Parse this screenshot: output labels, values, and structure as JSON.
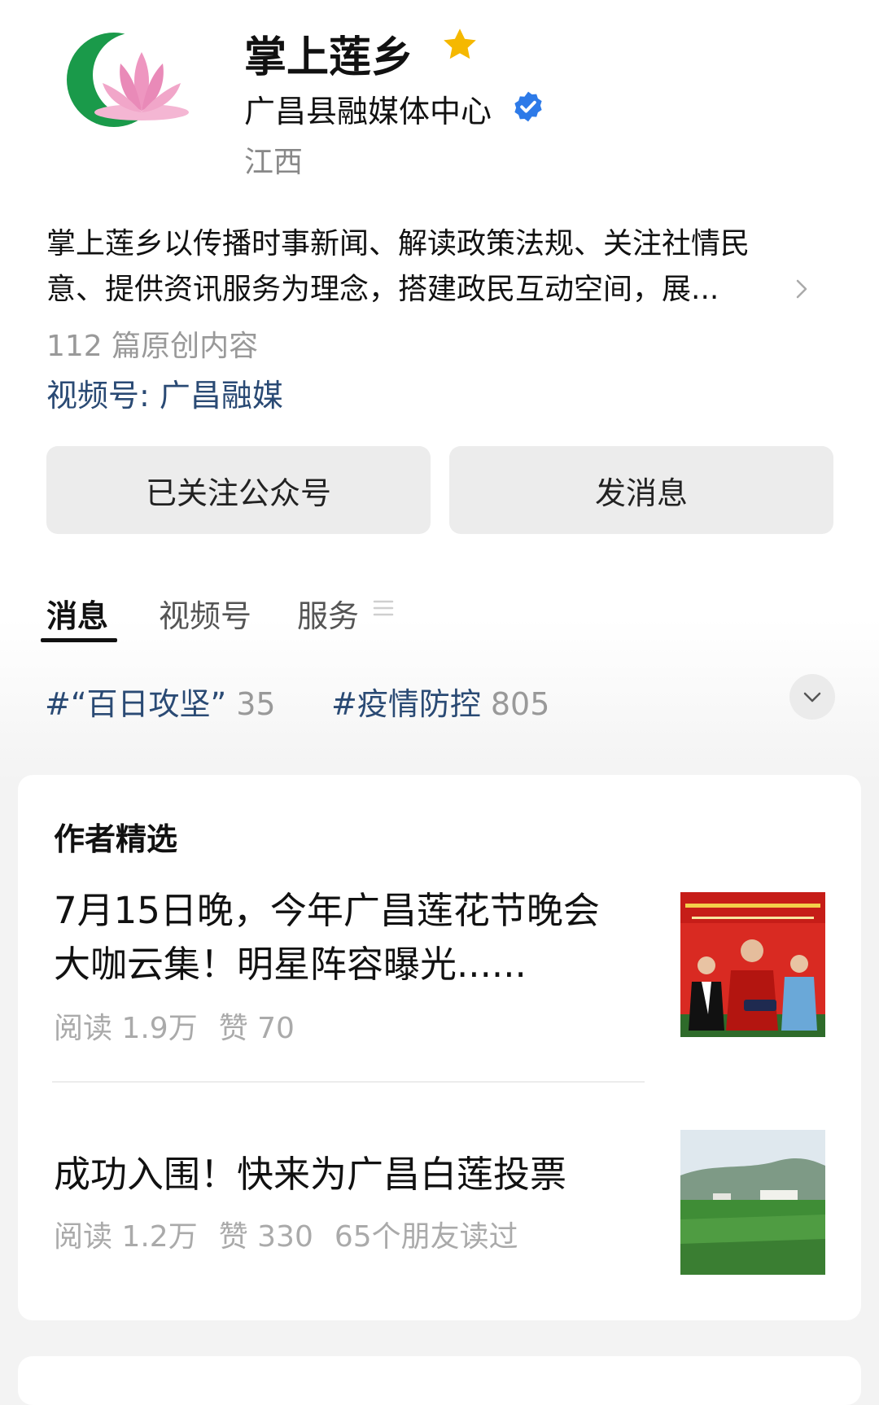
{
  "header": {
    "title": "掌上莲乡",
    "org": "广昌县融媒体中心",
    "region": "江西"
  },
  "description": {
    "line1": "掌上莲乡以传播时事新闻、解读政策法规、关注社情民",
    "line2": "意、提供资讯服务为理念，搭建政民互动空间，展..."
  },
  "stats": {
    "original_count": "112 篇原创内容"
  },
  "video_account": "视频号: 广昌融媒",
  "buttons": {
    "follow": "已关注公众号",
    "message": "发消息"
  },
  "tabs": [
    {
      "label": "消息",
      "active": true
    },
    {
      "label": "视频号",
      "active": false
    },
    {
      "label": "服务",
      "active": false
    }
  ],
  "hashtags": [
    {
      "label": "#“百日攻坚”",
      "count": "35"
    },
    {
      "label": "#疫情防控",
      "count": "805"
    }
  ],
  "featured": {
    "title": "作者精选",
    "articles": [
      {
        "title_line1": "7月15日晚，今年广昌莲花节晚会",
        "title_line2": "大咖云集！明星阵容曝光......",
        "reads": "阅读 1.9万",
        "likes": "赞 70",
        "friends": ""
      },
      {
        "title": "成功入围！快来为广昌白莲投票",
        "reads": "阅读 1.2万",
        "likes": "赞 330",
        "friends": "65个朋友读过"
      }
    ]
  },
  "colors": {
    "link_blue": "#2a4a74",
    "verified_blue": "#2d7ae8",
    "star_yellow": "#f5b800",
    "logo_green": "#1a9a4a",
    "lotus_pink": "#e98ab8"
  },
  "icons": [
    "logo-icon",
    "star-icon",
    "verified-icon",
    "chevron-right-icon",
    "menu-icon",
    "chevron-down-icon"
  ]
}
